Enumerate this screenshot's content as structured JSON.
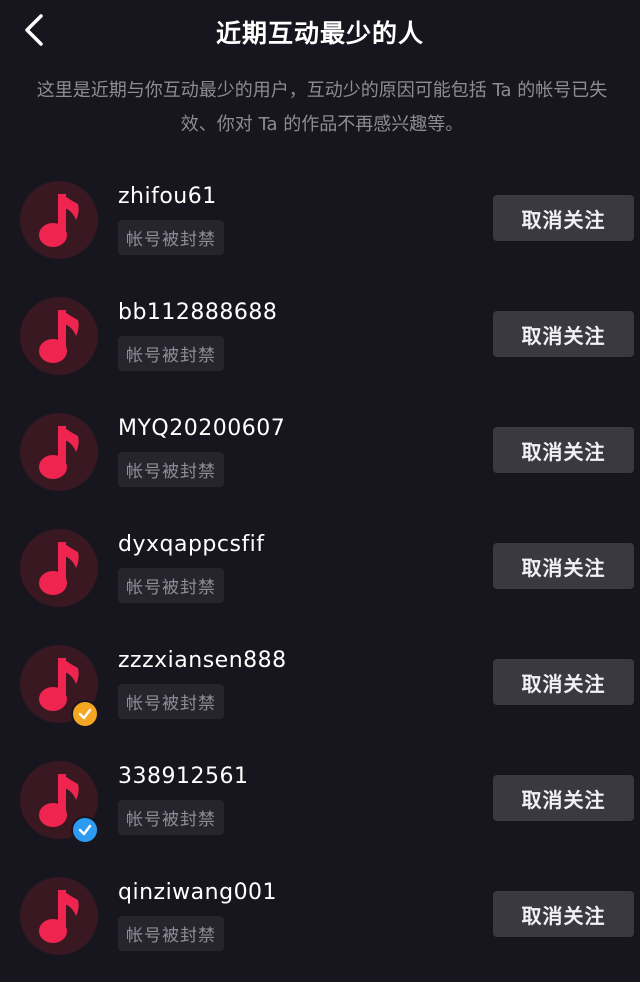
{
  "header": {
    "title": "近期互动最少的人",
    "back_icon": "chevron-left-icon"
  },
  "description": "这里是近期与你互动最少的用户，互动少的原因可能包括 Ta 的帐号已失效、你对 Ta 的作品不再感兴趣等。",
  "colors": {
    "background": "#17161f",
    "avatar_note": "#f0254f",
    "button_bg": "#3a3942",
    "badge_orange": "#f5a623",
    "badge_blue": "#2d9cf0"
  },
  "users": [
    {
      "username": "zhifou61",
      "status": "帐号被封禁",
      "button": "取消关注",
      "avatar_icon": "music-note-icon",
      "badge": null
    },
    {
      "username": "bb112888688",
      "status": "帐号被封禁",
      "button": "取消关注",
      "avatar_icon": "music-note-icon",
      "badge": null
    },
    {
      "username": "MYQ20200607",
      "status": "帐号被封禁",
      "button": "取消关注",
      "avatar_icon": "music-note-icon",
      "badge": null
    },
    {
      "username": "dyxqappcsfif",
      "status": "帐号被封禁",
      "button": "取消关注",
      "avatar_icon": "music-note-icon",
      "badge": null
    },
    {
      "username": "zzzxiansen888",
      "status": "帐号被封禁",
      "button": "取消关注",
      "avatar_icon": "music-note-icon",
      "badge": "orange"
    },
    {
      "username": "338912561",
      "status": "帐号被封禁",
      "button": "取消关注",
      "avatar_icon": "music-note-icon",
      "badge": "blue"
    },
    {
      "username": "qinziwang001",
      "status": "帐号被封禁",
      "button": "取消关注",
      "avatar_icon": "music-note-icon",
      "badge": null
    }
  ]
}
